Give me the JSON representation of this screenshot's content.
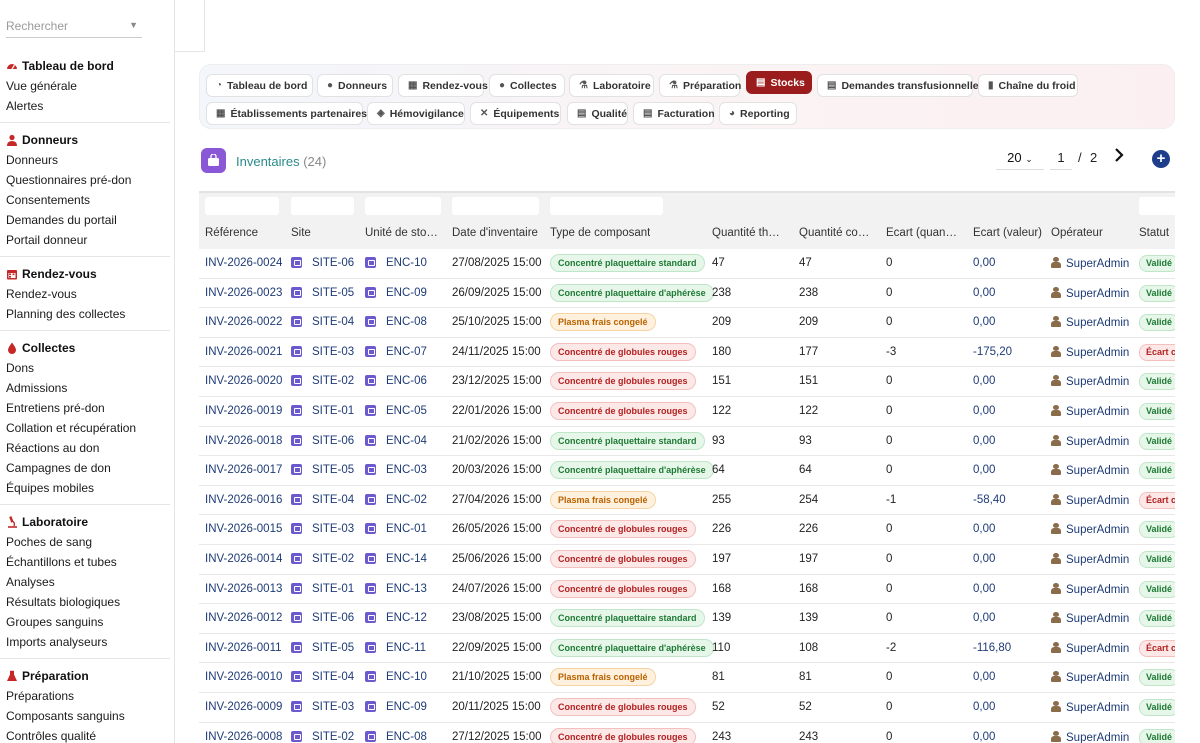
{
  "sidebar": {
    "search_placeholder": "Rechercher",
    "sections": [
      {
        "title": "Tableau de bord",
        "icon": "gauge-icon",
        "items": [
          "Vue générale",
          "Alertes"
        ]
      },
      {
        "title": "Donneurs",
        "icon": "user-icon",
        "items": [
          "Donneurs",
          "Questionnaires pré-don",
          "Consentements",
          "Demandes du portail",
          "Portail donneur"
        ]
      },
      {
        "title": "Rendez-vous",
        "icon": "calendar-icon",
        "items": [
          "Rendez-vous",
          "Planning des collectes"
        ]
      },
      {
        "title": "Collectes",
        "icon": "blood-drop-icon",
        "items": [
          "Dons",
          "Admissions",
          "Entretiens pré-don",
          "Collation et récupération",
          "Réactions au don",
          "Campagnes de don",
          "Équipes mobiles"
        ]
      },
      {
        "title": "Laboratoire",
        "icon": "microscope-icon",
        "items": [
          "Poches de sang",
          "Échantillons et tubes",
          "Analyses",
          "Résultats biologiques",
          "Groupes sanguins",
          "Imports analyseurs"
        ]
      },
      {
        "title": "Préparation",
        "icon": "flask-icon",
        "items": [
          "Préparations",
          "Composants sanguins",
          "Contrôles qualité"
        ]
      }
    ]
  },
  "tabs": [
    {
      "label": "Tableau de bord",
      "icon": "gauge-icon",
      "active": false
    },
    {
      "label": "Donneurs",
      "icon": "user-icon",
      "active": false
    },
    {
      "label": "Rendez-vous",
      "icon": "calendar-icon",
      "active": false
    },
    {
      "label": "Collectes",
      "icon": "blood-drop-icon",
      "active": false
    },
    {
      "label": "Laboratoire",
      "icon": "microscope-icon",
      "active": false
    },
    {
      "label": "Préparation",
      "icon": "flask-icon",
      "active": false
    },
    {
      "label": "Stocks",
      "icon": "warehouse-icon",
      "active": true
    },
    {
      "label": "Demandes transfusionnelles",
      "icon": "document-icon",
      "active": false
    },
    {
      "label": "Chaîne du froid",
      "icon": "thermometer-icon",
      "active": false
    },
    {
      "label": "Établissements partenaires",
      "icon": "hospital-icon",
      "active": false
    },
    {
      "label": "Hémovigilance",
      "icon": "shield-icon",
      "active": false
    },
    {
      "label": "Équipements",
      "icon": "tools-icon",
      "active": false
    },
    {
      "label": "Qualité",
      "icon": "clipboard-icon",
      "active": false
    },
    {
      "label": "Facturation",
      "icon": "invoice-icon",
      "active": false
    },
    {
      "label": "Reporting",
      "icon": "chart-pie-icon",
      "active": false
    }
  ],
  "page": {
    "title": "Inventaires",
    "count": "(24)",
    "page_size": "20",
    "current_page": "1",
    "page_separator": "/",
    "total_pages": "2"
  },
  "table": {
    "columns": [
      "Référence",
      "Site",
      "Unité de stockage",
      "Date d'inventaire",
      "Type de composant",
      "Quantité théorique",
      "Quantité comptée",
      "Écart (quantité)",
      "Écart (valeur)",
      "Opérateur",
      "Statut"
    ],
    "rows": [
      {
        "ref": "INV-2026-0024",
        "site": "SITE-06",
        "unit": "ENC-10",
        "date": "27/08/2025 15:00",
        "type": "Concentré plaquettaire standard",
        "type_color": "green",
        "qth": "47",
        "qco": "47",
        "eq": "0",
        "ev": "0,00",
        "op": "SuperAdmin",
        "status": "Validé",
        "status_color": "ok"
      },
      {
        "ref": "INV-2026-0023",
        "site": "SITE-05",
        "unit": "ENC-09",
        "date": "26/09/2025 15:00",
        "type": "Concentré plaquettaire d'aphérèse",
        "type_color": "green",
        "qth": "238",
        "qco": "238",
        "eq": "0",
        "ev": "0,00",
        "op": "SuperAdmin",
        "status": "Validé",
        "status_color": "ok"
      },
      {
        "ref": "INV-2026-0022",
        "site": "SITE-04",
        "unit": "ENC-08",
        "date": "25/10/2025 15:00",
        "type": "Plasma frais congelé",
        "type_color": "orange",
        "qth": "209",
        "qco": "209",
        "eq": "0",
        "ev": "0,00",
        "op": "SuperAdmin",
        "status": "Validé",
        "status_color": "ok"
      },
      {
        "ref": "INV-2026-0021",
        "site": "SITE-03",
        "unit": "ENC-07",
        "date": "24/11/2025 15:00",
        "type": "Concentré de globules rouges",
        "type_color": "red",
        "qth": "180",
        "qco": "177",
        "eq": "-3",
        "ev": "-175,20",
        "op": "SuperAdmin",
        "status": "Écart c",
        "status_color": "ko"
      },
      {
        "ref": "INV-2026-0020",
        "site": "SITE-02",
        "unit": "ENC-06",
        "date": "23/12/2025 15:00",
        "type": "Concentré de globules rouges",
        "type_color": "red",
        "qth": "151",
        "qco": "151",
        "eq": "0",
        "ev": "0,00",
        "op": "SuperAdmin",
        "status": "Validé",
        "status_color": "ok"
      },
      {
        "ref": "INV-2026-0019",
        "site": "SITE-01",
        "unit": "ENC-05",
        "date": "22/01/2026 15:00",
        "type": "Concentré de globules rouges",
        "type_color": "red",
        "qth": "122",
        "qco": "122",
        "eq": "0",
        "ev": "0,00",
        "op": "SuperAdmin",
        "status": "Validé",
        "status_color": "ok"
      },
      {
        "ref": "INV-2026-0018",
        "site": "SITE-06",
        "unit": "ENC-04",
        "date": "21/02/2026 15:00",
        "type": "Concentré plaquettaire standard",
        "type_color": "green",
        "qth": "93",
        "qco": "93",
        "eq": "0",
        "ev": "0,00",
        "op": "SuperAdmin",
        "status": "Validé",
        "status_color": "ok"
      },
      {
        "ref": "INV-2026-0017",
        "site": "SITE-05",
        "unit": "ENC-03",
        "date": "20/03/2026 15:00",
        "type": "Concentré plaquettaire d'aphérèse",
        "type_color": "green",
        "qth": "64",
        "qco": "64",
        "eq": "0",
        "ev": "0,00",
        "op": "SuperAdmin",
        "status": "Validé",
        "status_color": "ok"
      },
      {
        "ref": "INV-2026-0016",
        "site": "SITE-04",
        "unit": "ENC-02",
        "date": "27/04/2026 15:00",
        "type": "Plasma frais congelé",
        "type_color": "orange",
        "qth": "255",
        "qco": "254",
        "eq": "-1",
        "ev": "-58,40",
        "op": "SuperAdmin",
        "status": "Écart c",
        "status_color": "ko"
      },
      {
        "ref": "INV-2026-0015",
        "site": "SITE-03",
        "unit": "ENC-01",
        "date": "26/05/2026 15:00",
        "type": "Concentré de globules rouges",
        "type_color": "red",
        "qth": "226",
        "qco": "226",
        "eq": "0",
        "ev": "0,00",
        "op": "SuperAdmin",
        "status": "Validé",
        "status_color": "ok"
      },
      {
        "ref": "INV-2026-0014",
        "site": "SITE-02",
        "unit": "ENC-14",
        "date": "25/06/2026 15:00",
        "type": "Concentré de globules rouges",
        "type_color": "red",
        "qth": "197",
        "qco": "197",
        "eq": "0",
        "ev": "0,00",
        "op": "SuperAdmin",
        "status": "Validé",
        "status_color": "ok"
      },
      {
        "ref": "INV-2026-0013",
        "site": "SITE-01",
        "unit": "ENC-13",
        "date": "24/07/2026 15:00",
        "type": "Concentré de globules rouges",
        "type_color": "red",
        "qth": "168",
        "qco": "168",
        "eq": "0",
        "ev": "0,00",
        "op": "SuperAdmin",
        "status": "Validé",
        "status_color": "ok"
      },
      {
        "ref": "INV-2026-0012",
        "site": "SITE-06",
        "unit": "ENC-12",
        "date": "23/08/2025 15:00",
        "type": "Concentré plaquettaire standard",
        "type_color": "green",
        "qth": "139",
        "qco": "139",
        "eq": "0",
        "ev": "0,00",
        "op": "SuperAdmin",
        "status": "Validé",
        "status_color": "ok"
      },
      {
        "ref": "INV-2026-0011",
        "site": "SITE-05",
        "unit": "ENC-11",
        "date": "22/09/2025 15:00",
        "type": "Concentré plaquettaire d'aphérèse",
        "type_color": "green",
        "qth": "110",
        "qco": "108",
        "eq": "-2",
        "ev": "-116,80",
        "op": "SuperAdmin",
        "status": "Écart c",
        "status_color": "ko"
      },
      {
        "ref": "INV-2026-0010",
        "site": "SITE-04",
        "unit": "ENC-10",
        "date": "21/10/2025 15:00",
        "type": "Plasma frais congelé",
        "type_color": "orange",
        "qth": "81",
        "qco": "81",
        "eq": "0",
        "ev": "0,00",
        "op": "SuperAdmin",
        "status": "Validé",
        "status_color": "ok"
      },
      {
        "ref": "INV-2026-0009",
        "site": "SITE-03",
        "unit": "ENC-09",
        "date": "20/11/2025 15:00",
        "type": "Concentré de globules rouges",
        "type_color": "red",
        "qth": "52",
        "qco": "52",
        "eq": "0",
        "ev": "0,00",
        "op": "SuperAdmin",
        "status": "Validé",
        "status_color": "ok"
      },
      {
        "ref": "INV-2026-0008",
        "site": "SITE-02",
        "unit": "ENC-08",
        "date": "27/12/2025 15:00",
        "type": "Concentré de globules rouges",
        "type_color": "red",
        "qth": "243",
        "qco": "243",
        "eq": "0",
        "ev": "0,00",
        "op": "SuperAdmin",
        "status": "Validé",
        "status_color": "ok"
      }
    ]
  }
}
